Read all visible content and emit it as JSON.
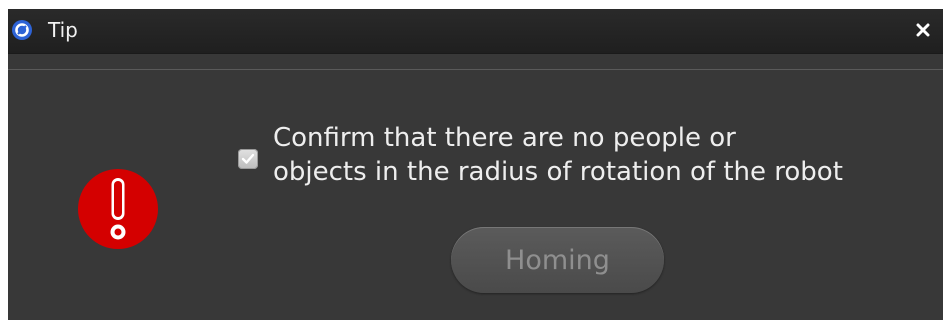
{
  "window": {
    "title": "Tip",
    "app_icon": "app-logo-icon",
    "close_icon": "close-icon"
  },
  "content": {
    "warning_icon": "warning-exclamation-icon",
    "checkbox_checked": true,
    "message_line1": "Confirm that there are no people or",
    "message_line2": "objects in the radius of rotation of the robot"
  },
  "actions": {
    "homing_label": "Homing",
    "homing_enabled": false
  },
  "colors": {
    "warning_red": "#d40000",
    "dialog_background": "#383838",
    "titlebar": "#222222"
  }
}
